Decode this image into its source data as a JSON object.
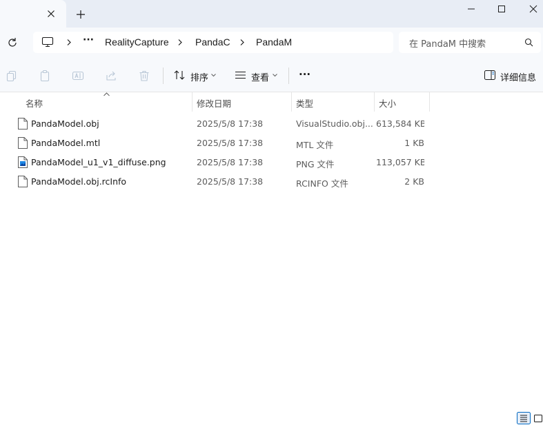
{
  "window": {
    "tab_close_label": "×",
    "new_tab_label": "+"
  },
  "address": {
    "overflow": "···",
    "crumbs": [
      "RealityCapture",
      "PandaC",
      "PandaM"
    ]
  },
  "search": {
    "placeholder": "在 PandaM 中搜索"
  },
  "toolbar": {
    "sort_label": "排序",
    "view_label": "查看",
    "more_label": "···",
    "details_label": "详细信息"
  },
  "columns": {
    "name": "名称",
    "date": "修改日期",
    "type": "类型",
    "size": "大小"
  },
  "files": [
    {
      "name": "PandaModel.obj",
      "date": "2025/5/8 17:38",
      "type": "VisualStudio.obj....",
      "size": "613,584 KB",
      "icon": "file-icon"
    },
    {
      "name": "PandaModel.mtl",
      "date": "2025/5/8 17:38",
      "type": "MTL 文件",
      "size": "1 KB",
      "icon": "file-icon"
    },
    {
      "name": "PandaModel_u1_v1_diffuse.png",
      "date": "2025/5/8 17:38",
      "type": "PNG 文件",
      "size": "113,057 KB",
      "icon": "image-file-icon"
    },
    {
      "name": "PandaModel.obj.rcInfo",
      "date": "2025/5/8 17:38",
      "type": "RCINFO 文件",
      "size": "2 KB",
      "icon": "file-icon"
    }
  ],
  "colors": {
    "accent": "#0067c0",
    "titlebar": "#e8edf5",
    "chrome": "#f7f9fc"
  }
}
